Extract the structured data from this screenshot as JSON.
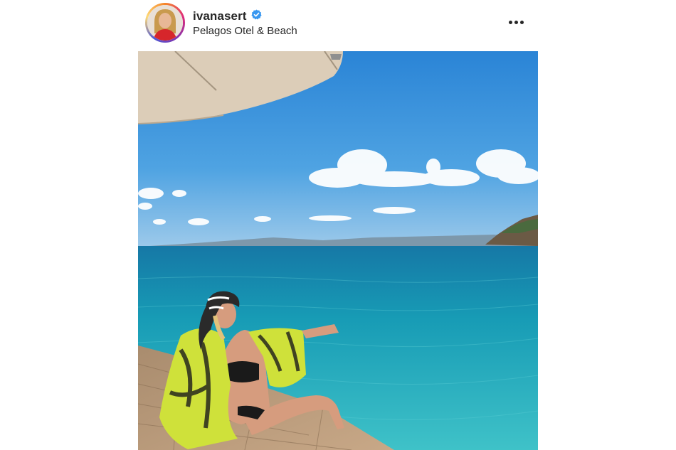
{
  "post": {
    "username": "ivanasert",
    "verified": true,
    "location": "Pelagos Otel & Beach"
  },
  "icons": {
    "verified": "verified-badge-icon",
    "more": "more-options-icon"
  },
  "colors": {
    "text": "#262626",
    "verified_blue": "#3897f0",
    "sky": "#2f8fd8",
    "sea": "#1aa3b8"
  }
}
